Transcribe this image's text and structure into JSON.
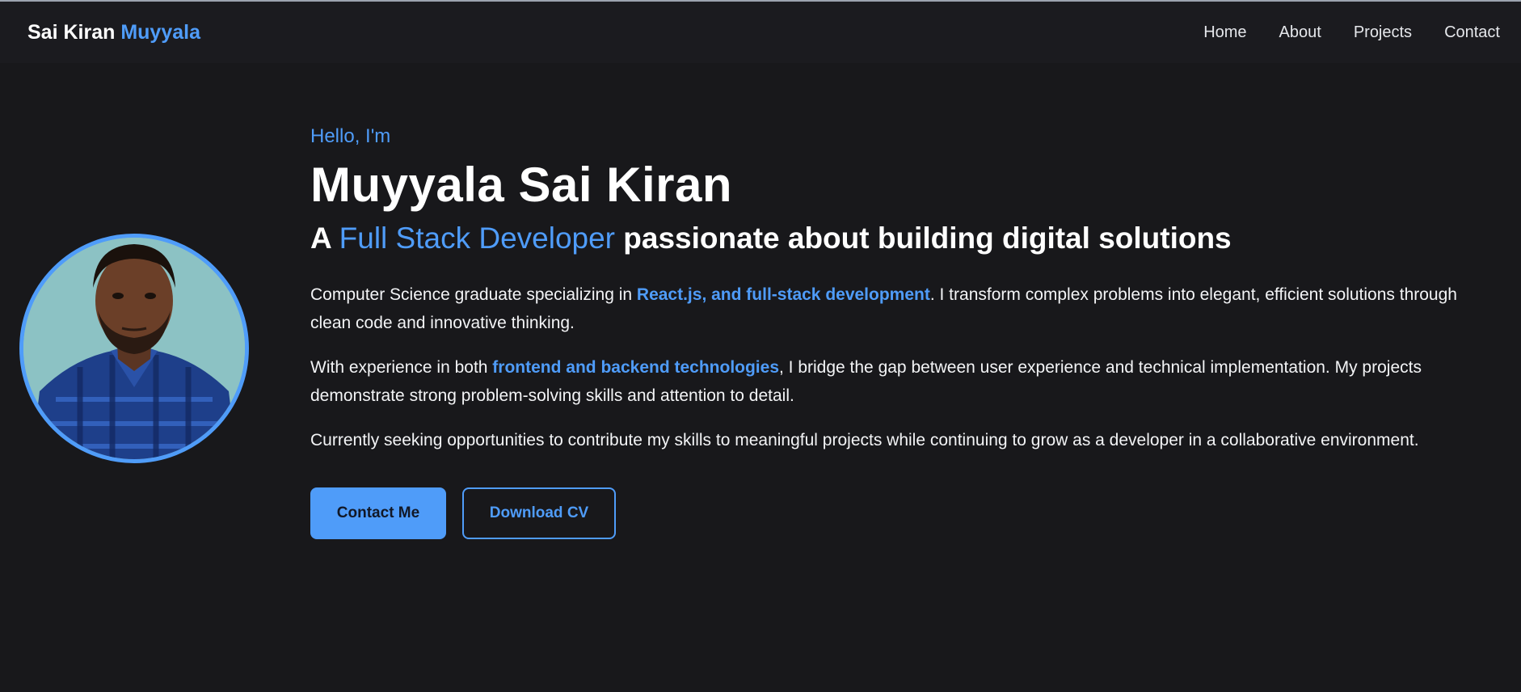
{
  "colors": {
    "accent": "#4f9cf9",
    "background": "#18181b",
    "navbar": "#1b1b1f"
  },
  "navbar": {
    "brand_first": "Sai Kiran",
    "brand_last": "Muyyala",
    "links": [
      "Home",
      "About",
      "Projects",
      "Contact"
    ]
  },
  "hero": {
    "greeting": "Hello, I'm",
    "name": "Muyyala Sai Kiran",
    "tagline_prefix": "A",
    "tagline_highlight": "Full Stack Developer",
    "tagline_suffix": "passionate about building digital solutions",
    "avatar_icon": "profile-photo",
    "paragraphs": [
      {
        "before": "Computer Science graduate specializing in ",
        "highlight": "React.js, and full-stack development",
        "after": ". I transform complex problems into elegant, efficient solutions through clean code and innovative thinking."
      },
      {
        "before": "With experience in both ",
        "highlight": "frontend and backend technologies",
        "after": ", I bridge the gap between user experience and technical implementation. My projects demonstrate strong problem-solving skills and attention to detail."
      },
      {
        "text": "Currently seeking opportunities to contribute my skills to meaningful projects while continuing to grow as a developer in a collaborative environment."
      }
    ],
    "buttons": {
      "contact": "Contact Me",
      "download": "Download CV"
    }
  }
}
